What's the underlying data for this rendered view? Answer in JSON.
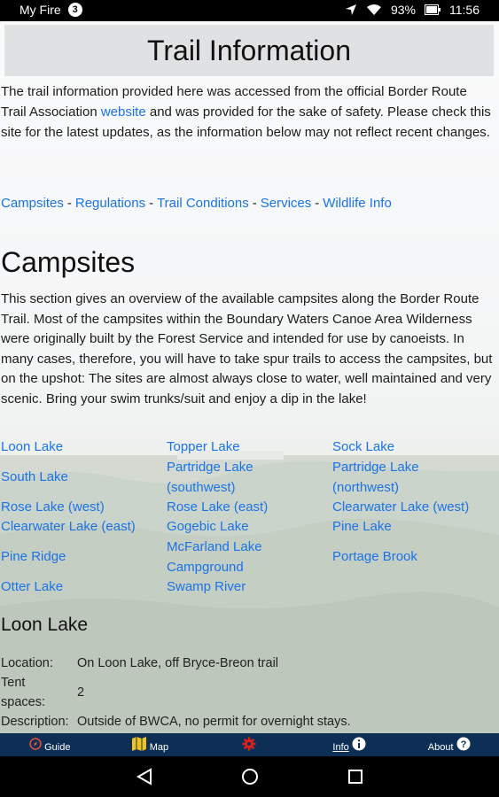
{
  "status_bar": {
    "carrier": "My Fire",
    "badge": "3",
    "battery": "93%",
    "time": "11:56"
  },
  "page": {
    "title": "Trail Information",
    "intro_before": "The trail information provided here was accessed from the official Border Route Trail Association ",
    "intro_link": "website",
    "intro_after": " and was provided for the sake of safety. Please check this site for the latest updates, as the information below may not reflect recent changes."
  },
  "nav_links": [
    "Campsites",
    "Regulations",
    "Trail Conditions",
    "Services",
    "Wildlife Info"
  ],
  "nav_separator": "-",
  "campsites": {
    "heading": "Campsites",
    "text": "This section gives an overview of the available campsites along the Border Route Trail. Most of the campsites within the Boundary Waters Canoe Area Wilderness were originally built by the Forest Service and intended for use by canoeists. In many cases, therefore, you will have to take spur trails to access the campsites, but on the upshot: The sites are almost always close to water, well maintained and very scenic. Bring your swim trunks/suit and enjoy a dip in the lake!",
    "grid": [
      [
        "Loon Lake",
        "Topper Lake",
        "Sock Lake"
      ],
      [
        "South Lake",
        "Partridge Lake (southwest)",
        "Partridge Lake (northwest)"
      ],
      [
        "Rose Lake (west)",
        "Rose Lake (east)",
        "Clearwater Lake (west)"
      ],
      [
        "Clearwater Lake (east)",
        "Gogebic Lake",
        "Pine Lake"
      ],
      [
        "Pine Ridge",
        "McFarland Lake Campground",
        "Portage Brook"
      ],
      [
        "Otter Lake",
        "Swamp River",
        ""
      ]
    ]
  },
  "site_detail": {
    "name": "Loon Lake",
    "location_label": "Location:",
    "location_value": "On Loon Lake, off Bryce-Breon trail",
    "tent_label_1": "Tent",
    "tent_label_2": "spaces:",
    "tent_value": "2",
    "description_label": "Description:",
    "description_value": "Outside of BWCA, no permit for overnight stays."
  },
  "tabs": [
    {
      "label": "Guide",
      "icon": "compass-icon",
      "active": false
    },
    {
      "label": "Map",
      "icon": "map-icon",
      "active": false
    },
    {
      "label": "",
      "icon": "gear-icon",
      "active": false
    },
    {
      "label": "Info",
      "icon": "info-icon",
      "active": true
    },
    {
      "label": "About",
      "icon": "help-icon",
      "active": false
    }
  ],
  "colors": {
    "link": "#1a73e8",
    "tabbar": "#0e2f55",
    "gear": "#e0201b",
    "guide_icon": "#e8503a",
    "map_icon": "#f2c21c"
  }
}
